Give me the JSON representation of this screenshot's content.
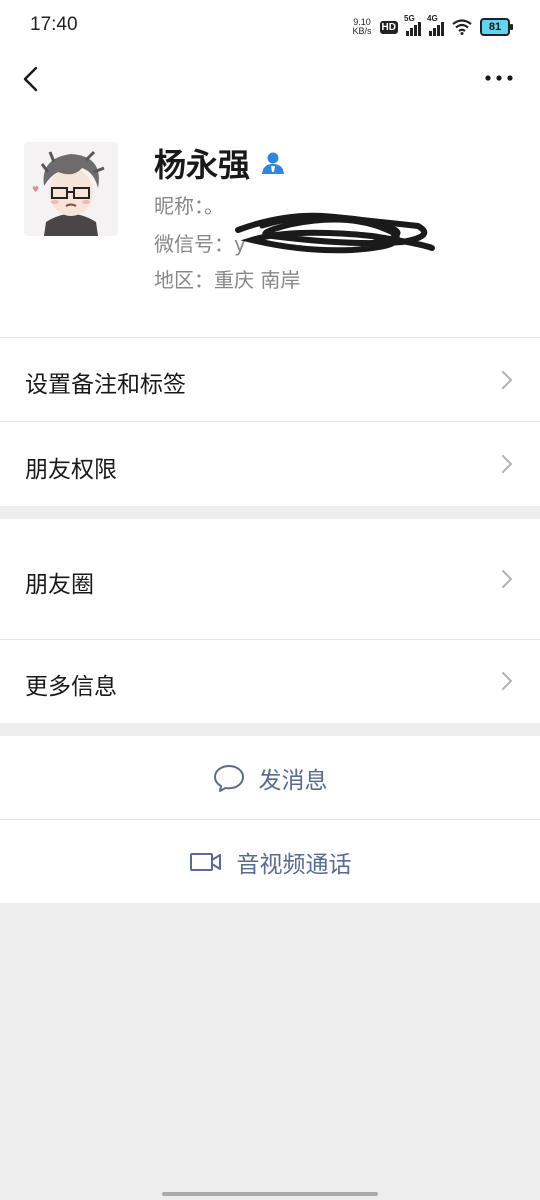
{
  "status_bar": {
    "time": "17:40",
    "net_speed_value": "9.10",
    "net_speed_unit": "KB/s",
    "hd_label": "HD",
    "signal1_label": "5G",
    "signal2_label": "4G",
    "battery": "81"
  },
  "profile": {
    "name": "杨永强",
    "nickname": "昵称：。",
    "wechat_id": "微信号：y",
    "region": "地区：重庆  南岸"
  },
  "menu": {
    "remark_tags": "设置备注和标签",
    "friend_permissions": "朋友权限",
    "moments": "朋友圈",
    "more_info": "更多信息"
  },
  "actions": {
    "send_message": "发消息",
    "av_call": "音视频通话"
  },
  "colors": {
    "link_blue": "#576b95",
    "badge_blue": "#2f86e1",
    "background": "#ededed"
  }
}
